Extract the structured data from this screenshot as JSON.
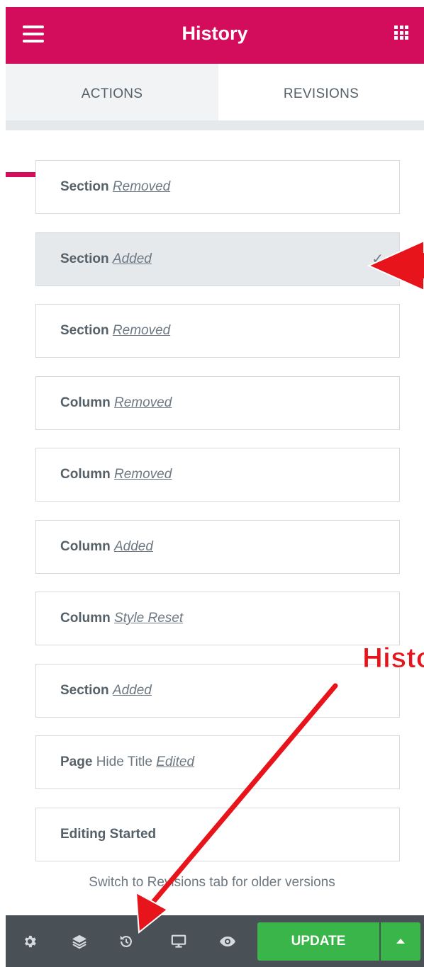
{
  "header": {
    "title": "History",
    "color": "#d30c5c"
  },
  "tabs": [
    {
      "label": "ACTIONS",
      "active": true
    },
    {
      "label": "REVISIONS",
      "active": false
    }
  ],
  "history_items": [
    {
      "element": "Section",
      "detail": "",
      "action": "Removed",
      "selected": false
    },
    {
      "element": "Section",
      "detail": "",
      "action": "Added",
      "selected": true,
      "check": "✓"
    },
    {
      "element": "Section",
      "detail": "",
      "action": "Removed",
      "selected": false
    },
    {
      "element": "Column",
      "detail": "",
      "action": "Removed",
      "selected": false
    },
    {
      "element": "Column",
      "detail": "",
      "action": "Removed",
      "selected": false
    },
    {
      "element": "Column",
      "detail": "",
      "action": "Added",
      "selected": false
    },
    {
      "element": "Column",
      "detail": "",
      "action": "Style Reset",
      "selected": false
    },
    {
      "element": "Section",
      "detail": "",
      "action": "Added",
      "selected": false
    },
    {
      "element": "Page",
      "detail": "Hide Title",
      "action": "Edited",
      "selected": false
    },
    {
      "element": "Editing Started",
      "detail": "",
      "action": "",
      "selected": false
    }
  ],
  "hint": "Switch to Revisions tab for older versions",
  "footer": {
    "icons": [
      "gear-icon",
      "layers-icon",
      "history-icon",
      "responsive-icon",
      "eye-icon"
    ],
    "update_label": "UPDATE",
    "update_color": "#39b54a"
  },
  "annotation": {
    "text": "Histo",
    "color": "#e8141b"
  }
}
